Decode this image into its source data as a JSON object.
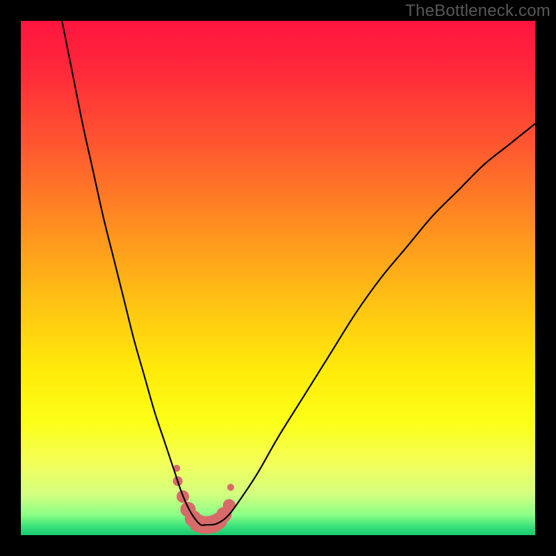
{
  "watermark": "TheBottleneck.com",
  "colors": {
    "gradient_stops": [
      {
        "offset": 0.0,
        "color": "#ff153e"
      },
      {
        "offset": 0.1,
        "color": "#ff2a3a"
      },
      {
        "offset": 0.25,
        "color": "#ff5a2f"
      },
      {
        "offset": 0.4,
        "color": "#ff8f20"
      },
      {
        "offset": 0.55,
        "color": "#ffc313"
      },
      {
        "offset": 0.68,
        "color": "#ffeb0a"
      },
      {
        "offset": 0.78,
        "color": "#fbff17"
      },
      {
        "offset": 0.86,
        "color": "#f3ff5a"
      },
      {
        "offset": 0.92,
        "color": "#d3ff7f"
      },
      {
        "offset": 0.96,
        "color": "#8dff86"
      },
      {
        "offset": 0.985,
        "color": "#34e07a"
      },
      {
        "offset": 1.0,
        "color": "#18c96e"
      }
    ],
    "curve_stroke": "#000000",
    "marker_fill": "#d86a6a",
    "marker_stroke": "#d86a6a"
  },
  "chart_data": {
    "type": "line",
    "title": "",
    "xlabel": "",
    "ylabel": "",
    "xlim": [
      0,
      100
    ],
    "ylim": [
      0,
      100
    ],
    "grid": false,
    "series": [
      {
        "name": "bottleneck-curve",
        "x": [
          8,
          10,
          12,
          14,
          16,
          18,
          20,
          22,
          24,
          26,
          28,
          30,
          31,
          32,
          33,
          34,
          35,
          36,
          38,
          40,
          42,
          46,
          50,
          55,
          60,
          65,
          70,
          75,
          80,
          85,
          90,
          95,
          100
        ],
        "y": [
          100,
          90,
          80,
          71,
          62,
          54,
          46,
          38,
          31,
          24,
          18,
          12,
          9,
          6.5,
          4.5,
          3,
          2,
          2,
          2.2,
          3.5,
          6,
          12,
          19,
          27,
          35,
          43,
          50,
          56,
          62,
          67,
          72,
          76,
          80
        ]
      }
    ],
    "markers": {
      "name": "highlight-region",
      "x": [
        30.5,
        31.5,
        32.5,
        33.5,
        34.5,
        35.5,
        36.5,
        37.5,
        38.5,
        39.5,
        40.5
      ],
      "y": [
        10.5,
        7.5,
        5.0,
        3.2,
        2.3,
        2.0,
        2.0,
        2.2,
        2.8,
        4.0,
        5.8
      ],
      "r": [
        7,
        9,
        11,
        12,
        13,
        13,
        13,
        13,
        12,
        11,
        9
      ]
    }
  }
}
